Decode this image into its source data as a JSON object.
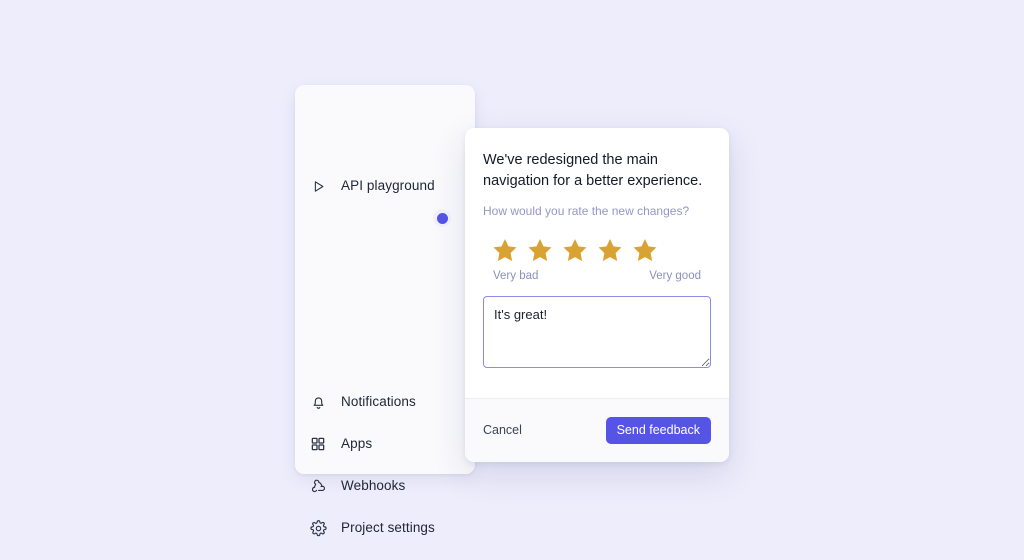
{
  "theme": {
    "page_background": "#ededfc",
    "accent": "#5654e6",
    "star_color": "#d9a334",
    "muted_text": "#9298c6",
    "card_background": "#fafafd",
    "dialog_background": "#ffffff"
  },
  "sidebar": {
    "items": [
      {
        "label": "API playground",
        "icon": "play-triangle-icon"
      },
      {
        "label": "Notifications",
        "icon": "bell-icon"
      },
      {
        "label": "Apps",
        "icon": "grid-icon"
      },
      {
        "label": "Webhooks",
        "icon": "webhook-icon"
      },
      {
        "label": "Project settings",
        "icon": "gear-icon"
      }
    ],
    "indicator": {
      "name": "notification-dot",
      "color": "#5654e6"
    }
  },
  "dialog": {
    "title": "We've redesigned the main navigation for a better experience.",
    "subtitle": "How would you rate the new changes?",
    "rating": {
      "value": 5,
      "max": 5,
      "low_label": "Very bad",
      "high_label": "Very good"
    },
    "comment": {
      "value": "It's great!",
      "placeholder": ""
    },
    "footer": {
      "cancel_label": "Cancel",
      "submit_label": "Send feedback"
    }
  }
}
